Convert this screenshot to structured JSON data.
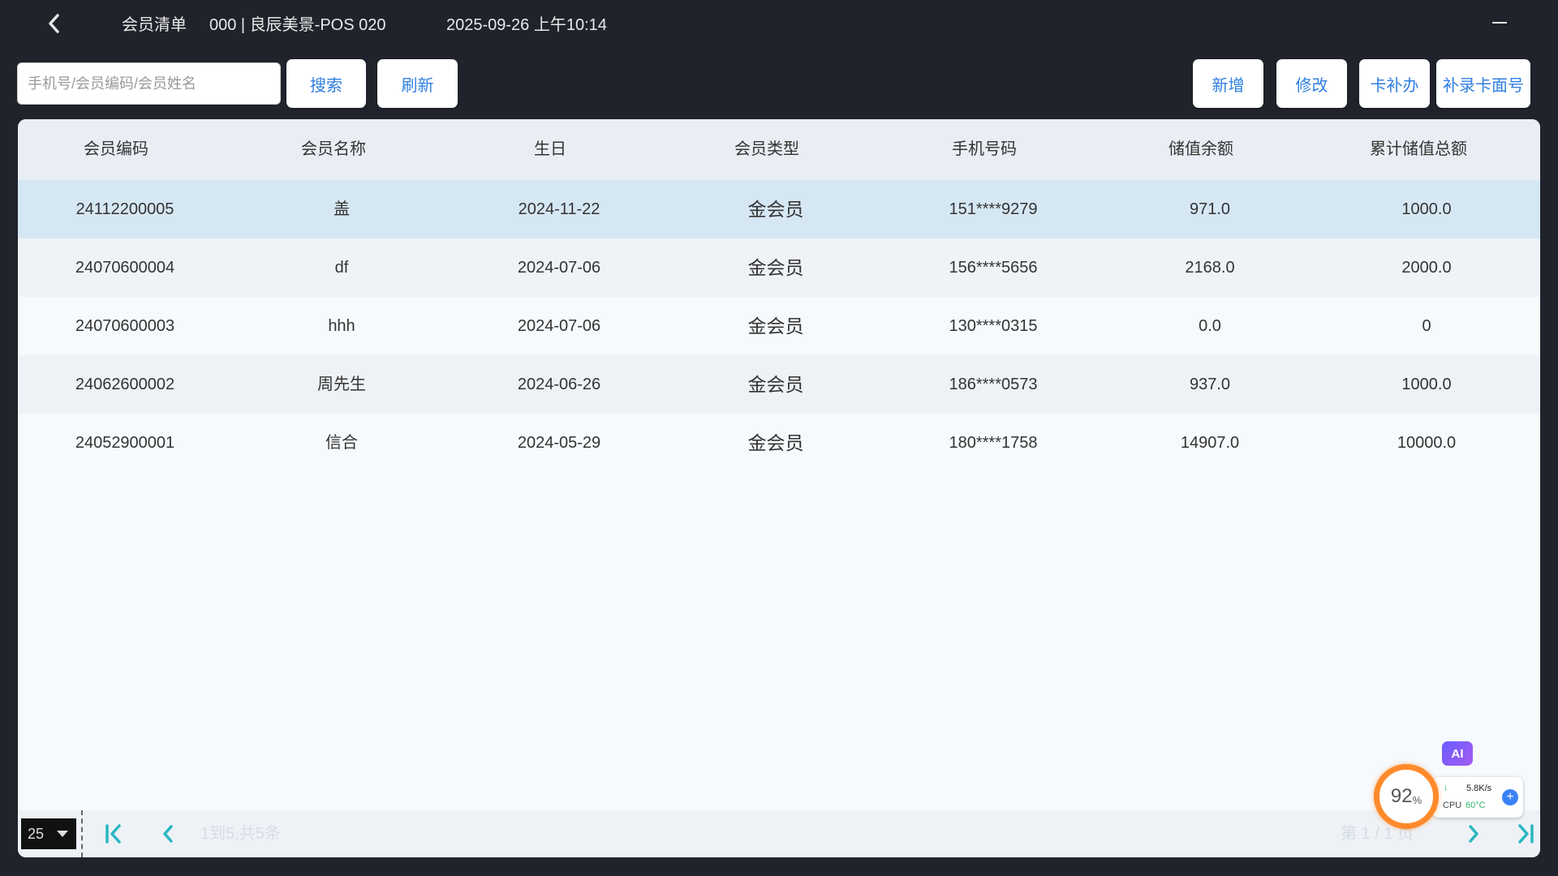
{
  "header": {
    "title": "会员清单",
    "store": "000 | 良辰美景-POS 020",
    "datetime": "2025-09-26 上午10:14"
  },
  "toolbar": {
    "search_placeholder": "手机号/会员编码/会员姓名",
    "search_value": "",
    "search_label": "搜索",
    "refresh_label": "刷新",
    "add_label": "新增",
    "edit_label": "修改",
    "reissue_label": "卡补办",
    "card_number_label": "补录卡面号"
  },
  "table": {
    "columns": [
      "会员编码",
      "会员名称",
      "生日",
      "会员类型",
      "手机号码",
      "储值余额",
      "累计储值总额"
    ],
    "rows": [
      [
        "24112200005",
        "盖",
        "2024-11-22",
        "金会员",
        "151****9279",
        "971.0",
        "1000.0"
      ],
      [
        "24070600004",
        "df",
        "2024-07-06",
        "金会员",
        "156****5656",
        "2168.0",
        "2000.0"
      ],
      [
        "24070600003",
        "hhh",
        "2024-07-06",
        "金会员",
        "130****0315",
        "0.0",
        "0"
      ],
      [
        "24062600002",
        "周先生",
        "2024-06-26",
        "金会员",
        "186****0573",
        "937.0",
        "1000.0"
      ],
      [
        "24052900001",
        "信合",
        "2024-05-29",
        "金会员",
        "180****1758",
        "14907.0",
        "10000.0"
      ]
    ]
  },
  "pager": {
    "page_size": "25",
    "info": "1到5,共5条",
    "page": "第 1 / 1 页"
  },
  "monitor": {
    "ai_label": "AI",
    "gauge_value": "92",
    "gauge_unit": "%",
    "net_arrow": "↓",
    "net_speed": "5.8K/s",
    "cpu_label": "CPU",
    "cpu_temp": "60°C",
    "plus": "+"
  },
  "colors": {
    "background": "#20232b",
    "accent": "#2f7fe0",
    "selected_row": "#d6e7f4",
    "pager_icon": "#2ab6c2",
    "gauge_ring": "#ff8a2b"
  }
}
